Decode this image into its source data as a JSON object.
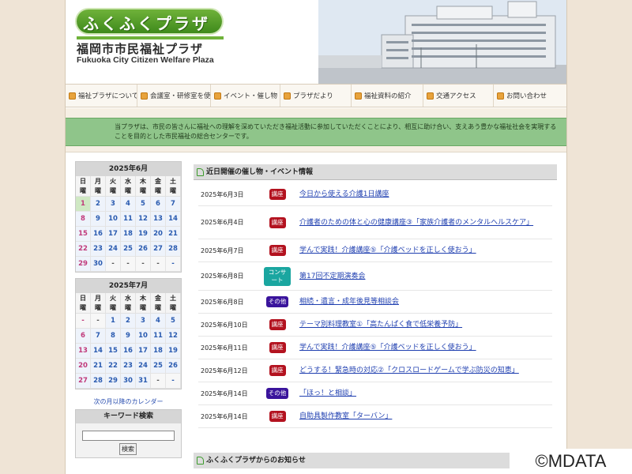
{
  "header": {
    "logo_text": "ふくふくプラザ",
    "title_ja": "福岡市市民福祉プラザ",
    "title_en": "Fukuoka City Citizen Welfare Plaza"
  },
  "nav": [
    {
      "label": "福祉プラザについて",
      "icon": "page-icon"
    },
    {
      "label": "会議室・研修室を使う",
      "icon": "meeting-icon"
    },
    {
      "label": "イベント・催し物",
      "icon": "event-icon"
    },
    {
      "label": "プラザだより",
      "icon": "newsletter-icon"
    },
    {
      "label": "福祉資料の紹介",
      "icon": "book-icon"
    },
    {
      "label": "交通アクセス",
      "icon": "bus-icon"
    },
    {
      "label": "お問い合わせ",
      "icon": "mail-icon"
    }
  ],
  "intro": "当プラザは、市民の皆さんに福祉への理解を深めていただき福祉活動に参加していただくことにより、相互に助け合い、支えあう豊かな福祉社会を実現することを目的とした市民福祉の総合センターです。",
  "calendar_june": {
    "title": "2025年6月",
    "weekdays": [
      "日曜",
      "月曜",
      "火曜",
      "水曜",
      "木曜",
      "金曜",
      "土曜"
    ],
    "days": [
      "1",
      "2",
      "3",
      "4",
      "5",
      "6",
      "7",
      "8",
      "9",
      "10",
      "11",
      "12",
      "13",
      "14",
      "15",
      "16",
      "17",
      "18",
      "19",
      "20",
      "21",
      "22",
      "23",
      "24",
      "25",
      "26",
      "27",
      "28",
      "29",
      "30",
      "-",
      "-",
      "-",
      "-",
      "-"
    ]
  },
  "calendar_july": {
    "title": "2025年7月",
    "weekdays": [
      "日曜",
      "月曜",
      "火曜",
      "水曜",
      "木曜",
      "金曜",
      "土曜"
    ],
    "days": [
      "-",
      "-",
      "1",
      "2",
      "3",
      "4",
      "5",
      "6",
      "7",
      "8",
      "9",
      "10",
      "11",
      "12",
      "13",
      "14",
      "15",
      "16",
      "17",
      "18",
      "19",
      "20",
      "21",
      "22",
      "23",
      "24",
      "25",
      "26",
      "27",
      "28",
      "29",
      "30",
      "31",
      "-",
      "-"
    ]
  },
  "calendar_next_link": "次の月以降のカレンダー",
  "keyword_search": {
    "title": "キーワード検索",
    "input_value": "",
    "button_label": "検索"
  },
  "events_header": "近日開催の催し物・イベント情報",
  "events": [
    {
      "date": "2025年6月3日",
      "badge": "講座",
      "title": "今日から使える介護1日講座"
    },
    {
      "date": "2025年6月4日",
      "badge": "講座",
      "title": "介護者のための体と心の健康講座③「家族介護者のメンタルヘルスケア」"
    },
    {
      "date": "2025年6月7日",
      "badge": "講座",
      "title": "学んで実践！介護講座⑤「介護ベッドを正しく使おう」"
    },
    {
      "date": "2025年6月8日",
      "badge": "コンサート",
      "title": "第17回不定期演奏会"
    },
    {
      "date": "2025年6月8日",
      "badge": "その他",
      "title": "相続・遺言・成年後見等相談会"
    },
    {
      "date": "2025年6月10日",
      "badge": "講座",
      "title": "テーマ別料理教室①「高たんぱく食で低栄養予防」"
    },
    {
      "date": "2025年6月11日",
      "badge": "講座",
      "title": "学んで実践！介護講座⑤「介護ベッドを正しく使おう」"
    },
    {
      "date": "2025年6月12日",
      "badge": "講座",
      "title": "どうする！緊急時の対応②「クロスロードゲームで学ぶ防災の知恵」"
    },
    {
      "date": "2025年6月14日",
      "badge": "その他",
      "title": "「ほっ！と相談」"
    },
    {
      "date": "2025年6月14日",
      "badge": "講座",
      "title": "自助具製作教室「ターバン」"
    }
  ],
  "badge_colors": {
    "講座": "#b3121f",
    "コンサート": "#1aa6a0",
    "その他": "#3a149c"
  },
  "notice_header": "ふくふくプラザからのお知らせ",
  "watermark": "©MDATA",
  "colors": {
    "intro_bg": "#8fc58a",
    "logo_green": "#5aa22d",
    "link_blue": "#1f3fb0"
  }
}
